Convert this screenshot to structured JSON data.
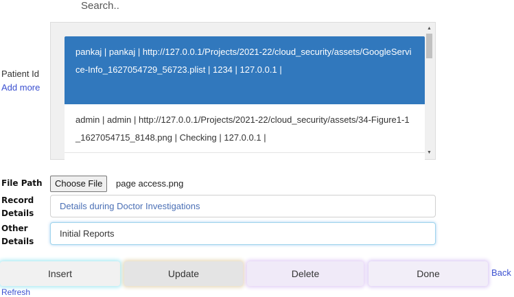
{
  "search": {
    "placeholder": "Search.."
  },
  "patient": {
    "label": "Patient Id",
    "add_more": "Add more",
    "items": [
      {
        "text": "pankaj | pankaj | http://127.0.0.1/Projects/2021-22/cloud_security/assets/GoogleService-Info_1627054729_56723.plist | 1234 | 127.0.0.1 |",
        "selected": true
      },
      {
        "text": "admin | admin | http://127.0.0.1/Projects/2021-22/cloud_security/assets/34-Figure1-1_1627054715_8148.png | Checking | 127.0.0.1 |",
        "selected": false
      }
    ]
  },
  "form": {
    "file_path_label": "File Path",
    "choose_file_label": "Choose File",
    "file_name": "page access.png",
    "record_label": "Record Details",
    "record_value": "Details during Doctor Investigations",
    "other_label": "Other Details",
    "other_value": "Initial Reports"
  },
  "actions": {
    "insert": "Insert",
    "update": "Update",
    "delete": "Delete",
    "done": "Done",
    "back": "Back",
    "refresh": "Refresh"
  },
  "colors": {
    "selected_row": "#3178bd",
    "link": "#3a4fd0"
  }
}
